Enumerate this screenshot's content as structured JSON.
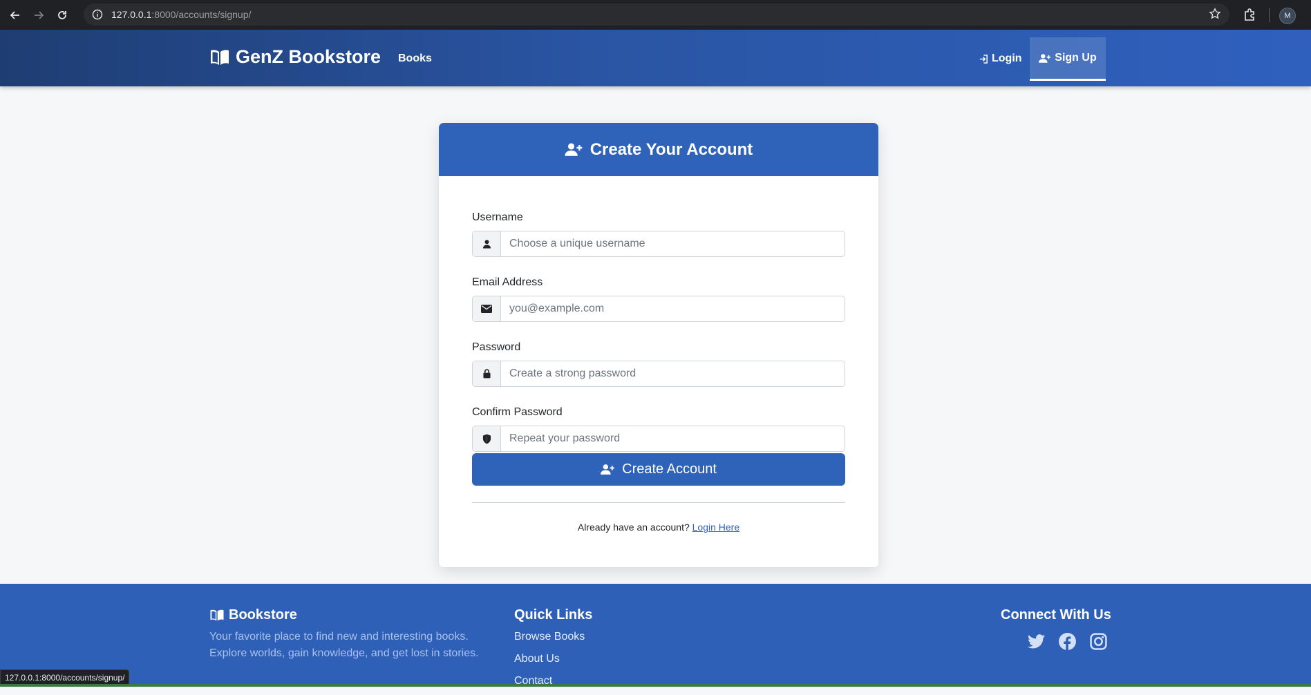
{
  "browser": {
    "url_host": "127.0.0.1",
    "url_path": ":8000/accounts/signup/",
    "profile_initial": "M",
    "status_url": "127.0.0.1:8000/accounts/signup/"
  },
  "navbar": {
    "brand": "GenZ Bookstore",
    "links": {
      "books": "Books",
      "login": "Login",
      "signup": "Sign Up"
    }
  },
  "signup_form": {
    "title": "Create Your Account",
    "fields": {
      "username": {
        "label": "Username",
        "placeholder": "Choose a unique username",
        "icon": "user-icon"
      },
      "email": {
        "label": "Email Address",
        "placeholder": "you@example.com",
        "icon": "envelope-icon"
      },
      "password": {
        "label": "Password",
        "placeholder": "Create a strong password",
        "icon": "lock-icon"
      },
      "confirm": {
        "label": "Confirm Password",
        "placeholder": "Repeat your password",
        "icon": "shield-icon"
      }
    },
    "submit_label": "Create Account",
    "already_text": "Already have an account?",
    "login_link": "Login Here"
  },
  "footer": {
    "brand": "Bookstore",
    "tagline": "Your favorite place to find new and interesting books. Explore worlds, gain knowledge, and get lost in stories.",
    "quick_links_title": "Quick Links",
    "quick_links": [
      "Browse Books",
      "About Us",
      "Contact"
    ],
    "connect_title": "Connect With Us",
    "social": [
      "twitter-icon",
      "facebook-icon",
      "instagram-icon"
    ]
  },
  "colors": {
    "primary": "#2f62b9",
    "navbar_dark": "#1e3d73",
    "footer": "#2f60b8",
    "page_bg": "#f6f7f9"
  }
}
